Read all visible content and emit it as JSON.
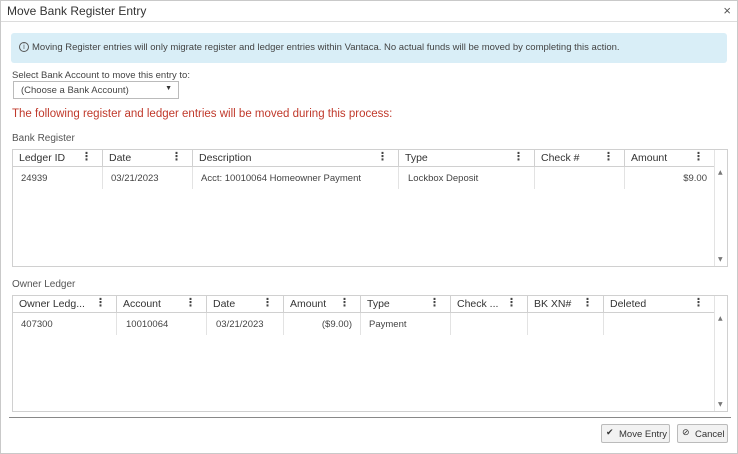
{
  "dialog": {
    "title": "Move Bank Register Entry",
    "close_glyph": "×"
  },
  "info": {
    "icon": "info-icon",
    "icon_glyph": "i",
    "text": "Moving Register entries will only migrate register and ledger entries within Vantaca. No actual funds will be moved by completing this action."
  },
  "bank_select": {
    "label": "Select Bank Account to move this entry to:",
    "value": "(Choose a Bank Account)"
  },
  "warning": {
    "text": "The following register and ledger entries will be moved during this process:",
    "color": "#c0392b"
  },
  "bank_register": {
    "label": "Bank Register",
    "columns": [
      "Ledger ID",
      "Date",
      "Description",
      "Type",
      "Check #",
      "Amount"
    ],
    "rows": [
      {
        "ledger_id": "24939",
        "date": "03/21/2023",
        "description": "Acct: 10010064 Homeowner Payment",
        "type": "Lockbox Deposit",
        "check": "",
        "amount": "$9.00"
      }
    ]
  },
  "owner_ledger": {
    "label": "Owner Ledger",
    "columns": [
      "Owner Ledg...",
      "Account",
      "Date",
      "Amount",
      "Type",
      "Check ...",
      "BK XN#",
      "Deleted"
    ],
    "rows": [
      {
        "owner_ledger": "407300",
        "account": "10010064",
        "date": "03/21/2023",
        "amount": "($9.00)",
        "type": "Payment",
        "check": "",
        "bk_xn": "",
        "deleted": ""
      }
    ]
  },
  "buttons": {
    "move_entry": "Move Entry",
    "move_entry_icon": "check-icon",
    "cancel": "Cancel",
    "cancel_icon": "cancel-circle-icon"
  }
}
